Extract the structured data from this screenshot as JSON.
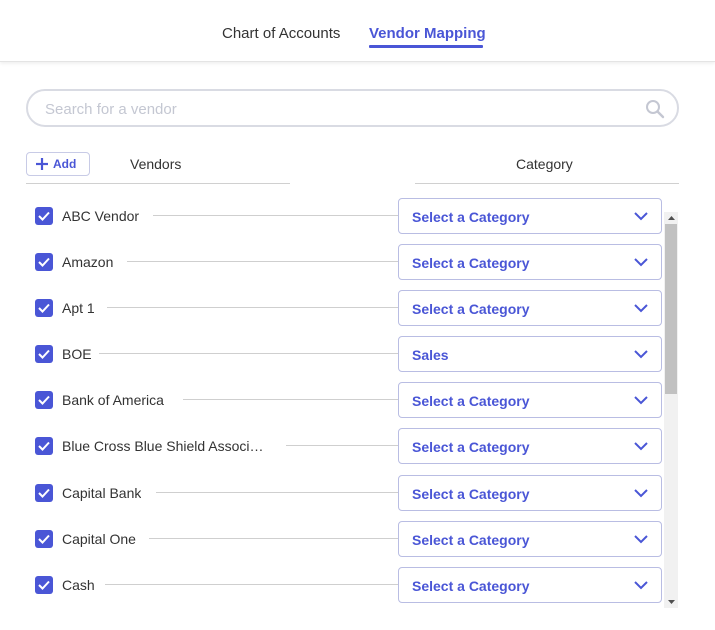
{
  "tabs": [
    {
      "label": "Chart of Accounts",
      "active": false
    },
    {
      "label": "Vendor Mapping",
      "active": true
    }
  ],
  "search": {
    "placeholder": "Search for a vendor",
    "value": ""
  },
  "toolbar": {
    "add_label": "Add"
  },
  "columns": {
    "vendors": "Vendors",
    "category": "Category"
  },
  "vendors": [
    {
      "name": "ABC Vendor",
      "checked": true,
      "category": "Select a Category"
    },
    {
      "name": "Amazon",
      "checked": true,
      "category": "Select a Category"
    },
    {
      "name": "Apt 1",
      "checked": true,
      "category": "Select a Category"
    },
    {
      "name": "BOE",
      "checked": true,
      "category": "Sales"
    },
    {
      "name": "Bank of America",
      "checked": true,
      "category": "Select a Category"
    },
    {
      "name": "Blue Cross Blue Shield Associ…",
      "checked": true,
      "category": "Select a Category"
    },
    {
      "name": "Capital Bank",
      "checked": true,
      "category": "Select a Category"
    },
    {
      "name": "Capital One",
      "checked": true,
      "category": "Select a Category"
    },
    {
      "name": "Cash",
      "checked": true,
      "category": "Select a Category"
    }
  ],
  "colors": {
    "accent": "#4a56d6",
    "border": "#b9bde3",
    "placeholder": "#c4c7d2"
  },
  "icons": {
    "search": "search-icon",
    "add": "plus-icon",
    "dropdown": "chevron-down-icon",
    "checkbox": "check-icon"
  }
}
